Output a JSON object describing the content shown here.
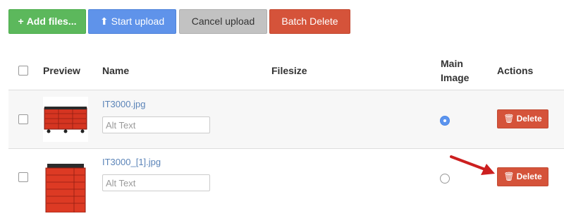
{
  "toolbar": {
    "add_files": {
      "icon": "plus-icon",
      "glyph": "+",
      "label": "Add files..."
    },
    "start_upload": {
      "icon": "upload-icon",
      "glyph": "⬆",
      "label": "Start upload"
    },
    "cancel_upload": {
      "label": "Cancel upload"
    },
    "batch_delete": {
      "label": "Batch Delete"
    }
  },
  "table": {
    "headers": {
      "preview": "Preview",
      "name": "Name",
      "filesize": "Filesize",
      "main_image_line1": "Main",
      "main_image_line2": "Image",
      "actions": "Actions"
    },
    "rows": [
      {
        "filename": "IT3000.jpg",
        "alt_placeholder": "Alt Text",
        "filesize": "",
        "main_image": true,
        "delete_label": "Delete",
        "delete_glyph": "🗑"
      },
      {
        "filename": "IT3000_[1].jpg",
        "alt_placeholder": "Alt Text",
        "filesize": "",
        "main_image": false,
        "delete_label": "Delete",
        "delete_glyph": "🗑"
      }
    ]
  },
  "colors": {
    "add_files": "#5cb85c",
    "start_upload": "#5f93ea",
    "cancel_upload": "#c2c2c2",
    "danger": "#d5533a",
    "link": "#5b84b8",
    "annotation_arrow": "#cc1f1f"
  }
}
